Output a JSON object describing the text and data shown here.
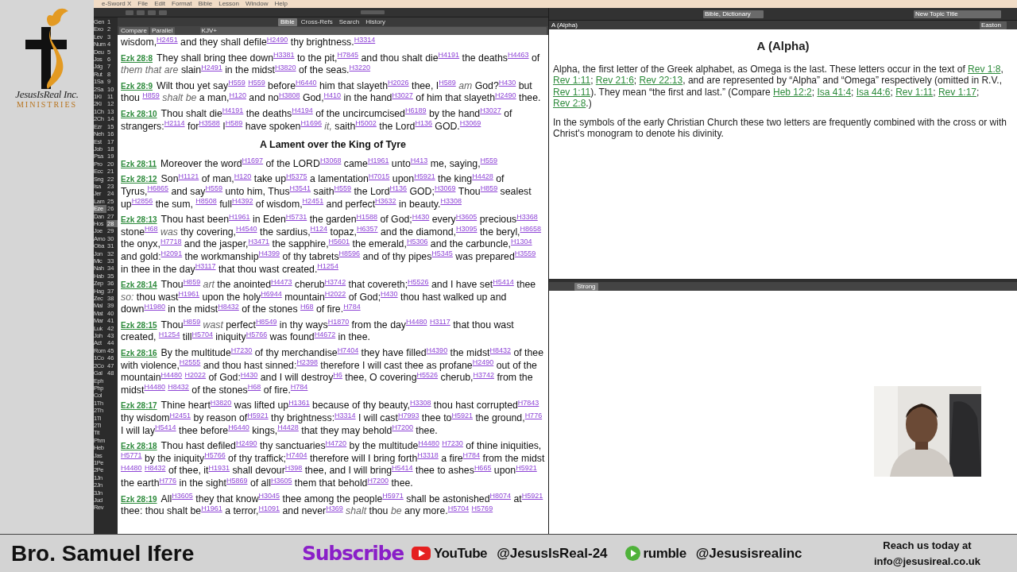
{
  "menu_bar": [
    "e-Sword X",
    "File",
    "Edit",
    "Format",
    "Bible",
    "Lesson",
    "Window",
    "Help"
  ],
  "bible_tabs": [
    {
      "label": "Bible",
      "selected": true
    },
    {
      "label": "Cross-Refs",
      "selected": false
    },
    {
      "label": "Search",
      "selected": false
    },
    {
      "label": "History",
      "selected": false
    }
  ],
  "bible_views": [
    "Compare",
    "Parallel"
  ],
  "translation": "KJV+",
  "books": [
    {
      "label": "Gen",
      "selected": false
    },
    {
      "label": "Exo",
      "selected": false
    },
    {
      "label": "Lev",
      "selected": false
    },
    {
      "label": "Num",
      "selected": false
    },
    {
      "label": "Deu",
      "selected": false
    },
    {
      "label": "Jos",
      "selected": false
    },
    {
      "label": "Jdg",
      "selected": false
    },
    {
      "label": "Rut",
      "selected": false
    },
    {
      "label": "1Sa",
      "selected": false
    },
    {
      "label": "2Sa",
      "selected": false
    },
    {
      "label": "1Ki",
      "selected": false
    },
    {
      "label": "2Ki",
      "selected": false
    },
    {
      "label": "1Ch",
      "selected": false
    },
    {
      "label": "2Ch",
      "selected": false
    },
    {
      "label": "Ezr",
      "selected": false
    },
    {
      "label": "Neh",
      "selected": false
    },
    {
      "label": "Est",
      "selected": false
    },
    {
      "label": "Job",
      "selected": false
    },
    {
      "label": "Psa",
      "selected": false
    },
    {
      "label": "Pro",
      "selected": false
    },
    {
      "label": "Ecc",
      "selected": false
    },
    {
      "label": "Sng",
      "selected": false
    },
    {
      "label": "Isa",
      "selected": false
    },
    {
      "label": "Jer",
      "selected": false
    },
    {
      "label": "Lam",
      "selected": false
    },
    {
      "label": "Eze",
      "selected": true
    },
    {
      "label": "Dan",
      "selected": false
    },
    {
      "label": "Hos",
      "selected": false
    },
    {
      "label": "Joe",
      "selected": false
    },
    {
      "label": "Amo",
      "selected": false
    },
    {
      "label": "Oba",
      "selected": false
    },
    {
      "label": "Jon",
      "selected": false
    },
    {
      "label": "Mic",
      "selected": false
    },
    {
      "label": "Nah",
      "selected": false
    },
    {
      "label": "Hab",
      "selected": false
    },
    {
      "label": "Zep",
      "selected": false
    },
    {
      "label": "Hag",
      "selected": false
    },
    {
      "label": "Zec",
      "selected": false
    },
    {
      "label": "Mal",
      "selected": false
    },
    {
      "label": "Mat",
      "selected": false
    },
    {
      "label": "Mar",
      "selected": false
    },
    {
      "label": "Luk",
      "selected": false
    },
    {
      "label": "Joh",
      "selected": false
    },
    {
      "label": "Act",
      "selected": false
    },
    {
      "label": "Rom",
      "selected": false
    },
    {
      "label": "1Co",
      "selected": false
    },
    {
      "label": "2Co",
      "selected": false
    },
    {
      "label": "Gal",
      "selected": false
    },
    {
      "label": "Eph",
      "selected": false
    },
    {
      "label": "Php",
      "selected": false
    },
    {
      "label": "Col",
      "selected": false
    },
    {
      "label": "1Th",
      "selected": false
    },
    {
      "label": "2Th",
      "selected": false
    },
    {
      "label": "1Ti",
      "selected": false
    },
    {
      "label": "2Ti",
      "selected": false
    },
    {
      "label": "Tit",
      "selected": false
    },
    {
      "label": "Phm",
      "selected": false
    },
    {
      "label": "Heb",
      "selected": false
    },
    {
      "label": "Jas",
      "selected": false
    },
    {
      "label": "1Pe",
      "selected": false
    },
    {
      "label": "2Pe",
      "selected": false
    },
    {
      "label": "1Jn",
      "selected": false
    },
    {
      "label": "2Jn",
      "selected": false
    },
    {
      "label": "3Jn",
      "selected": false
    },
    {
      "label": "Jud",
      "selected": false
    },
    {
      "label": "Rev",
      "selected": false
    }
  ],
  "chapters": [
    {
      "label": "1",
      "selected": false
    },
    {
      "label": "2",
      "selected": false
    },
    {
      "label": "3",
      "selected": false
    },
    {
      "label": "4",
      "selected": false
    },
    {
      "label": "5",
      "selected": false
    },
    {
      "label": "6",
      "selected": false
    },
    {
      "label": "7",
      "selected": false
    },
    {
      "label": "8",
      "selected": false
    },
    {
      "label": "9",
      "selected": false
    },
    {
      "label": "10",
      "selected": false
    },
    {
      "label": "11",
      "selected": false
    },
    {
      "label": "12",
      "selected": false
    },
    {
      "label": "13",
      "selected": false
    },
    {
      "label": "14",
      "selected": false
    },
    {
      "label": "15",
      "selected": false
    },
    {
      "label": "16",
      "selected": false
    },
    {
      "label": "17",
      "selected": false
    },
    {
      "label": "18",
      "selected": false
    },
    {
      "label": "19",
      "selected": false
    },
    {
      "label": "20",
      "selected": false
    },
    {
      "label": "21",
      "selected": false
    },
    {
      "label": "22",
      "selected": false
    },
    {
      "label": "23",
      "selected": false
    },
    {
      "label": "24",
      "selected": false
    },
    {
      "label": "25",
      "selected": false
    },
    {
      "label": "26",
      "selected": false
    },
    {
      "label": "27",
      "selected": false
    },
    {
      "label": "28",
      "selected": true
    },
    {
      "label": "29",
      "selected": false
    },
    {
      "label": "30",
      "selected": false
    },
    {
      "label": "31",
      "selected": false
    },
    {
      "label": "32",
      "selected": false
    },
    {
      "label": "33",
      "selected": false
    },
    {
      "label": "34",
      "selected": false
    },
    {
      "label": "35",
      "selected": false
    },
    {
      "label": "36",
      "selected": false
    },
    {
      "label": "37",
      "selected": false
    },
    {
      "label": "38",
      "selected": false
    },
    {
      "label": "39",
      "selected": false
    },
    {
      "label": "40",
      "selected": false
    },
    {
      "label": "41",
      "selected": false
    },
    {
      "label": "42",
      "selected": false
    },
    {
      "label": "43",
      "selected": false
    },
    {
      "label": "44",
      "selected": false
    },
    {
      "label": "45",
      "selected": false
    },
    {
      "label": "46",
      "selected": false
    },
    {
      "label": "47",
      "selected": false
    },
    {
      "label": "48",
      "selected": false
    }
  ],
  "passage": [
    {
      "kind": "continuation",
      "text": "wisdom,$^{H2451}$ and they shall defile$^{H2490}$ thy brightness.$^{H3314}$"
    },
    {
      "kind": "verse",
      "ref": "Ezk 28:8",
      "text": "They shall bring thee down$^{H3381}$ to the pit,$^{H7845}$ and thou shalt die$^{H4191}$ the deaths$^{H4463}$ of *them that are* slain$^{H2491}$ in the midst$^{H3820}$ of the seas.$^{H3220}$"
    },
    {
      "kind": "verse",
      "ref": "Ezk 28:9",
      "text": "Wilt thou yet say$^{H559}$ $^{H559}$ before$^{H6440}$ him that slayeth$^{H2026}$ thee, I$^{H589}$ *am* God?$^{H430}$ but thou $^{H859}$ *shalt be* a man,$^{H120}$ and no$^{H3808}$ God,$^{H410}$ in the hand$^{H3027}$ of him that slayeth$^{H2490}$ thee."
    },
    {
      "kind": "verse",
      "ref": "Ezk 28:10",
      "text": "Thou shalt die$^{H4191}$ the deaths$^{H4194}$ of the uncircumcised$^{H6189}$ by the hand$^{H3027}$ of strangers:$^{H2114}$ for$^{H3588}$ I$^{H589}$ have spoken$^{H1696}$ *it,* saith$^{H5002}$ the Lord$^{H136}$ GOD.$^{H3069}$"
    },
    {
      "kind": "heading",
      "text": "A Lament over the King of Tyre"
    },
    {
      "kind": "verse",
      "ref": "Ezk 28:11",
      "text": "Moreover the word$^{H1697}$ of the LORD$^{H3068}$ came$^{H1961}$ unto$^{H413}$ me, saying,$^{H559}$"
    },
    {
      "kind": "verse",
      "ref": "Ezk 28:12",
      "text": "Son$^{H1121}$ of man,$^{H120}$ take up$^{H5375}$ a lamentation$^{H7015}$ upon$^{H5921}$ the king$^{H4428}$ of Tyrus,$^{H6865}$ and say$^{H559}$ unto him, Thus$^{H3541}$ saith$^{H559}$ the Lord$^{H136}$ GOD;$^{H3069}$ Thou$^{H859}$ sealest up$^{H2856}$ the sum, $^{H8508}$ full$^{H4392}$ of wisdom,$^{H2451}$ and perfect$^{H3632}$ in beauty.$^{H3308}$"
    },
    {
      "kind": "verse",
      "ref": "Ezk 28:13",
      "text": "Thou hast been$^{H1961}$ in Eden$^{H5731}$ the garden$^{H1588}$ of God;$^{H430}$ every$^{H3605}$ precious$^{H3368}$ stone$^{H68}$ *was* thy covering,$^{H4540}$ the sardius,$^{H124}$ topaz,$^{H6357}$ and the diamond,$^{H3095}$ the beryl,$^{H8658}$ the onyx,$^{H7718}$ and the jasper,$^{H3471}$ the sapphire,$^{H5601}$ the emerald,$^{H5306}$ and the carbuncle,$^{H1304}$ and gold:$^{H2091}$ the workmanship$^{H4399}$ of thy tabrets$^{H8596}$ and of thy pipes$^{H5345}$ was prepared$^{H3559}$ in thee in the day$^{H3117}$ that thou wast created.$^{H1254}$"
    },
    {
      "kind": "verse",
      "ref": "Ezk 28:14",
      "text": "Thou$^{H859}$ *art* the anointed$^{H4473}$ cherub$^{H3742}$ that covereth;$^{H5526}$ and I have set$^{H5414}$ thee *so:* thou wast$^{H1961}$ upon the holy$^{H6944}$ mountain$^{H2022}$ of God;$^{H430}$ thou hast walked up and down$^{H1980}$ in the midst$^{H8432}$ of the stones $^{H68}$ of fire.$^{H784}$"
    },
    {
      "kind": "verse",
      "ref": "Ezk 28:15",
      "text": "Thou$^{H859}$ *wast* perfect$^{H8549}$ in thy ways$^{H1870}$ from the day$^{H4480}$ $^{H3117}$ that thou wast created, $^{H1254}$ till$^{H5704}$ iniquity$^{H5766}$ was found$^{H4672}$ in thee."
    },
    {
      "kind": "verse",
      "ref": "Ezk 28:16",
      "text": "By the multitude$^{H7230}$ of thy merchandise$^{H7404}$ they have filled$^{H4390}$ the midst$^{H8432}$ of thee with violence,$^{H2555}$ and thou hast sinned:$^{H2398}$ therefore I will cast thee as profane$^{H2490}$ out of the mountain$^{H4480}$ $^{H2022}$ of God:$^{H430}$ and I will destroy$^{H6}$ thee, O covering$^{H5526}$ cherub,$^{H3742}$ from the midst$^{H4480}$ $^{H8432}$ of the stones$^{H68}$ of fire.$^{H784}$"
    },
    {
      "kind": "verse",
      "ref": "Ezk 28:17",
      "text": "Thine heart$^{H3820}$ was lifted up$^{H1361}$ because of thy beauty,$^{H3308}$ thou hast corrupted$^{H7843}$ thy wisdom$^{H2451}$ by reason of$^{H5921}$ thy brightness:$^{H3314}$ I will cast$^{H7993}$ thee to$^{H5921}$ the ground,$^{H776}$ I will lay$^{H5414}$ thee before$^{H6440}$ kings,$^{H4428}$ that they may behold$^{H7200}$ thee."
    },
    {
      "kind": "verse",
      "ref": "Ezk 28:18",
      "text": "Thou hast defiled$^{H2490}$ thy sanctuaries$^{H4720}$ by the multitude$^{H4480}$ $^{H7230}$ of thine iniquities, $^{H5771}$ by the iniquity$^{H5766}$ of thy traffick;$^{H7404}$ therefore will I bring forth$^{H3318}$ a fire$^{H784}$ from the midst $^{H4480}$ $^{H8432}$ of thee, it$^{H1931}$ shall devour$^{H398}$ thee, and I will bring$^{H5414}$ thee to ashes$^{H665}$ upon$^{H5921}$ the earth$^{H776}$ in the sight$^{H5869}$ of all$^{H3605}$ them that behold$^{H7200}$ thee."
    },
    {
      "kind": "verse",
      "ref": "Ezk 28:19",
      "text": "All$^{H3605}$ they that know$^{H3045}$ thee among the people$^{H5971}$ shall be astonished$^{H8074}$ at$^{H5921}$ thee: thou shalt be$^{H1961}$ a terror,$^{H1091}$ and never$^{H369}$ *shalt* thou *be* any more.$^{H5704}$ $^{H5769}$"
    }
  ],
  "dictionary": {
    "module_select": "Bible, Dictionary",
    "topic_select": "New Topic Title",
    "search": "A (Alpha)",
    "dictionary_select": "Easton",
    "title": "A (Alpha)",
    "paragraphs": [
      [
        {
          "kind": "text",
          "text": "Alpha, the first letter of the Greek alphabet, as Omega is the last. These letters occur in the text of "
        },
        {
          "kind": "link",
          "text": "Rev 1:8"
        },
        {
          "kind": "text",
          "text": ", "
        },
        {
          "kind": "link",
          "text": "Rev 1:11"
        },
        {
          "kind": "text",
          "text": "; "
        },
        {
          "kind": "link",
          "text": "Rev 21:6"
        },
        {
          "kind": "text",
          "text": "; "
        },
        {
          "kind": "link",
          "text": "Rev 22:13"
        },
        {
          "kind": "text",
          "text": ", and are represented by “Alpha” and “Omega” respectively (omitted in R.V., "
        },
        {
          "kind": "link",
          "text": "Rev 1:11"
        },
        {
          "kind": "text",
          "text": "). They mean “the first and last.” (Compare "
        },
        {
          "kind": "link",
          "text": "Heb 12:2"
        },
        {
          "kind": "text",
          "text": "; "
        },
        {
          "kind": "link",
          "text": "Isa 41:4"
        },
        {
          "kind": "text",
          "text": "; "
        },
        {
          "kind": "link",
          "text": "Isa 44:6"
        },
        {
          "kind": "text",
          "text": "; "
        },
        {
          "kind": "link",
          "text": "Rev 1:11"
        },
        {
          "kind": "text",
          "text": "; "
        },
        {
          "kind": "link",
          "text": "Rev 1:17"
        },
        {
          "kind": "text",
          "text": "; "
        },
        {
          "kind": "link",
          "text": "Rev 2:8"
        },
        {
          "kind": "text",
          "text": ".)"
        }
      ],
      [
        {
          "kind": "text",
          "text": "In the symbols of the early Christian Church these two letters are frequently combined with the cross or with Christ's monogram to denote his divinity."
        }
      ]
    ]
  },
  "lower_pane": {
    "tab": "Strong"
  },
  "logo": {
    "name": "JesusIsReal Inc.",
    "tagline": "MINISTRIES"
  },
  "banner": {
    "presenter": "Bro. Samuel Ifere",
    "subscribe": "Subscribe",
    "channels": [
      {
        "kind": "youtube",
        "platform": "YouTube",
        "handle": "@JesusIsReal-24"
      },
      {
        "kind": "rumble",
        "platform": "rumble",
        "handle": "@Jesusisrealinc"
      }
    ],
    "contact": "Reach us today at",
    "email": "info@jesusireal.co.uk"
  }
}
